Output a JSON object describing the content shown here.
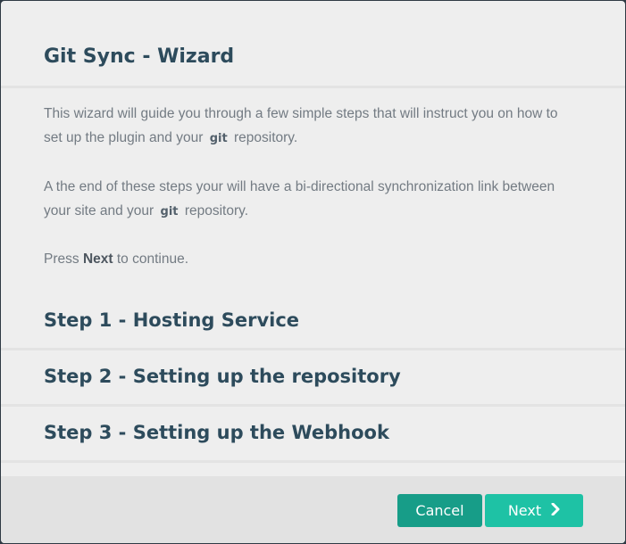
{
  "wizard": {
    "title": "Git Sync - Wizard",
    "intro": {
      "line1": "This wizard will guide you through a few simple steps that will instruct you on how to",
      "line2_pre": "set up the plugin and your",
      "git_label": "git",
      "line2_post": "repository."
    },
    "outcome": {
      "line1": "A the end of these steps your will have a bi-directional synchronization link between",
      "line2_pre": "your site and your",
      "git_label": "git",
      "line2_post": "repository."
    },
    "continue_hint": {
      "pre": "Press",
      "bold": "Next",
      "post": "to continue."
    },
    "steps": [
      {
        "label": "Step 1 - Hosting Service"
      },
      {
        "label": "Step 2 - Setting up the repository"
      },
      {
        "label": "Step 3 - Setting up the Webhook"
      }
    ]
  },
  "footer": {
    "cancel_label": "Cancel",
    "next_label": "Next",
    "next_icon": "chevron-right-icon"
  },
  "colors": {
    "heading": "#2d4b5c",
    "body_text": "#737b83",
    "cancel_bg": "#179d88",
    "next_bg": "#1ec2a5"
  }
}
